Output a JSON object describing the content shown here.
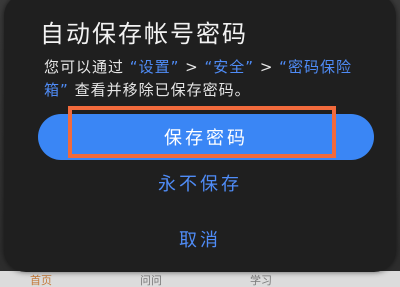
{
  "dialog": {
    "title": "自动保存帐号密码",
    "desc_prefix": "您可以通过",
    "link_settings": "“设置”",
    "sep1": ">",
    "link_security": "“安全”",
    "sep2": ">",
    "link_vault": "“密码保险箱”",
    "desc_suffix": "查看并移除已保存密码。",
    "save_label": "保存密码",
    "never_label": "永不保存",
    "cancel_label": "取消"
  },
  "bottom_tabs": [
    "首页",
    "问问",
    "学习"
  ],
  "colors": {
    "dialog_bg": "#1f1f1f",
    "accent": "#3a86f5",
    "link": "#4f8cf7",
    "highlight": "#f26a3c"
  }
}
